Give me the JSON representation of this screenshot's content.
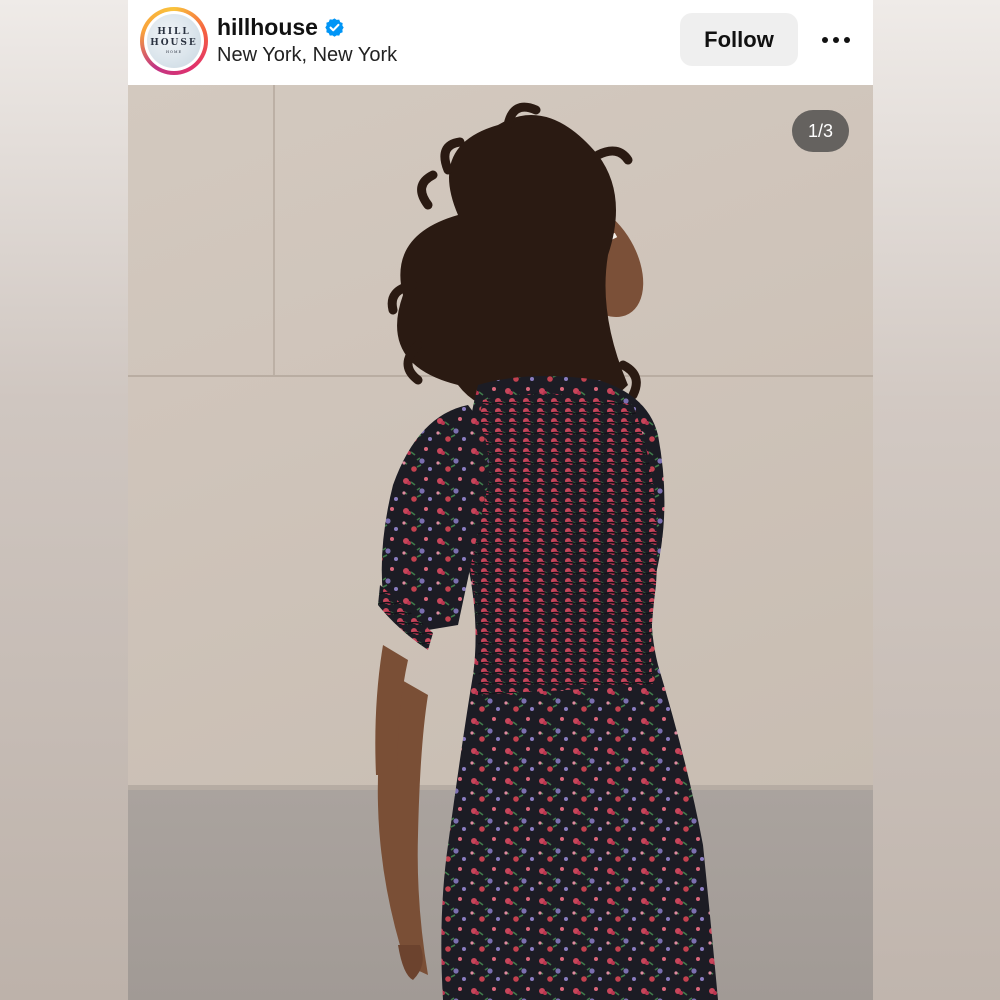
{
  "post": {
    "username": "hillhouse",
    "verified_icon": "verified-badge-icon",
    "location": "New York, New York",
    "follow_label": "Follow",
    "more_icon": "more-horizontal-icon",
    "avatar_logo": {
      "line1": "HILL",
      "line2": "HOUSE",
      "line3": "HOME"
    },
    "image_counter": "1/3"
  },
  "colors": {
    "verified": "#0095f6",
    "follow_bg": "#efefef",
    "text": "#111111"
  }
}
